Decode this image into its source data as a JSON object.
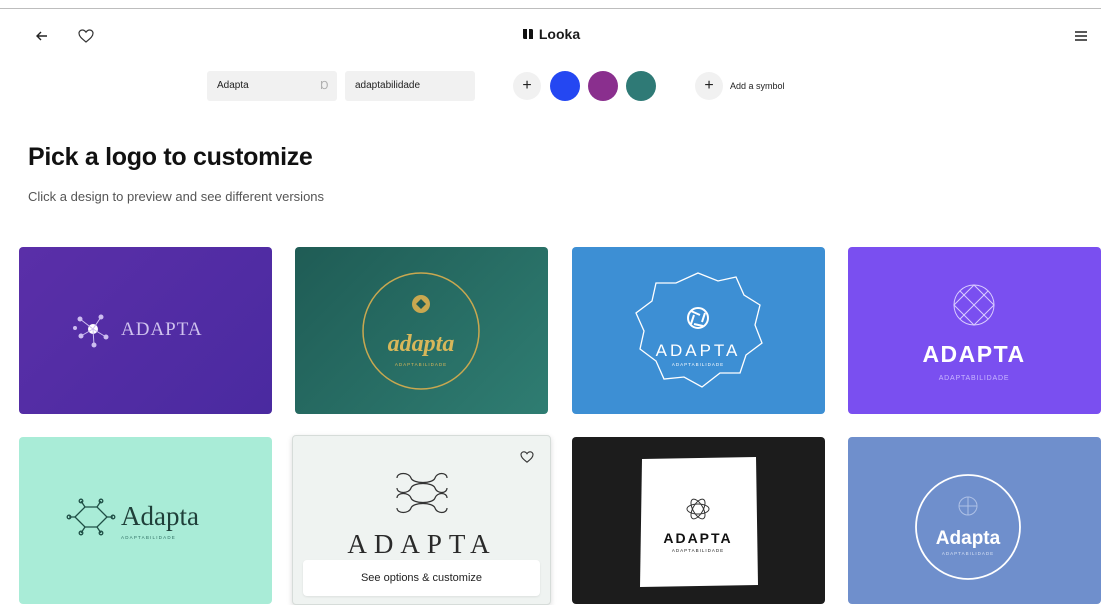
{
  "header": {
    "brand": "Looka",
    "back_icon": "arrow-left-icon",
    "favorite_icon": "heart-outline-icon",
    "menu_icon": "hamburger-menu-icon"
  },
  "toolbar": {
    "company_name": "Adapta",
    "slogan": "adaptabilidade",
    "add_color_label": "+",
    "colors": [
      "#2447f2",
      "#8a2f8e",
      "#2f7a76"
    ],
    "add_symbol_label": "Add a symbol"
  },
  "page": {
    "title": "Pick a logo to customize",
    "subtitle": "Click a design to preview and see different versions"
  },
  "cards": [
    {
      "name": "ADAPTA",
      "tagline": "",
      "bg": "#5a2fa8"
    },
    {
      "name": "adapta",
      "tagline": "ADAPTABILIDADE",
      "bg": "#2a6f66"
    },
    {
      "name": "ADAPTA",
      "tagline": "ADAPTABILIDADE",
      "bg": "#3d8fd4"
    },
    {
      "name": "ADAPTA",
      "tagline": "ADAPTABILIDADE",
      "bg": "#7a4ff0"
    },
    {
      "name": "Adapta",
      "tagline": "ADAPTABILIDADE",
      "bg": "#a9ecd7"
    },
    {
      "name": "ADAPTA",
      "tagline": "",
      "bg": "#eff3f1",
      "cta": "See options & customize"
    },
    {
      "name": "ADAPTA",
      "tagline": "ADAPTABILIDADE",
      "bg": "#1c1c1c"
    },
    {
      "name": "Adapta",
      "tagline": "ADAPTABILIDADE",
      "bg": "#6f8fcc"
    }
  ]
}
